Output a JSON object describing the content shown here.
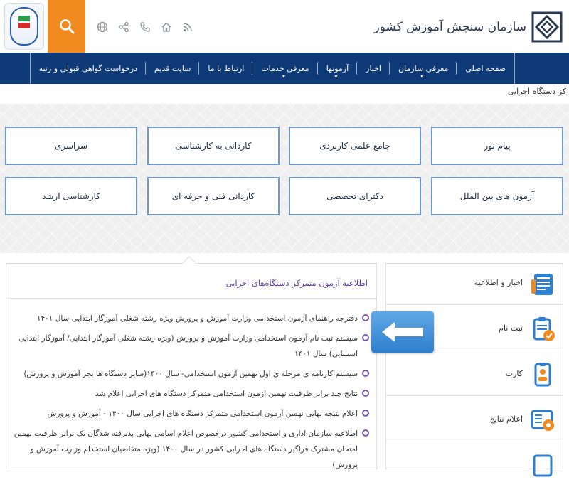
{
  "header": {
    "logo_text": "سازمان سنجش آموزش کشور",
    "icons": [
      "rss-icon",
      "home-icon",
      "phone-icon",
      "share-icon",
      "globe-icon"
    ]
  },
  "nav": {
    "items": [
      {
        "label": "صفحه اصلی",
        "dropdown": false
      },
      {
        "label": "معرفی سازمان",
        "dropdown": true
      },
      {
        "label": "اخبار",
        "dropdown": false
      },
      {
        "label": "آزمونها",
        "dropdown": true
      },
      {
        "label": "معرفی خدمات",
        "dropdown": true
      },
      {
        "label": "ارتباط با ما",
        "dropdown": false
      },
      {
        "label": "سایت قدیم",
        "dropdown": false
      },
      {
        "label": "درخواست گواهی قبولی و رتبه",
        "dropdown": false
      }
    ]
  },
  "breadcrumb": "کز دستگاه اجرایی",
  "categories": {
    "row1": [
      "پیام نور",
      "جامع علمی کاربردی",
      "کاردانی به کارشناسی",
      "سراسری"
    ],
    "row2": [
      "آزمون های بین الملل",
      "دکترای تخصصی",
      "کاردانی فنی و حرفه ای",
      "کارشناسی ارشد"
    ]
  },
  "announcements": {
    "title": "اطلاعیه آزمون متمرکز دستگاه‌های اجرایی",
    "items": [
      "دفترچه راهنمای آزمون استخدامی وزارت آموزش و پرورش ویژه رشته شغلی آموزگار ابتدایی سال ۱۴۰۱",
      "سیستم ثبت نام آزمون استخدامی وزارت آموزش و پرورش (ویژه رشته شغلی آموزگار ابتدایی/ آموزگار ابتدایی استثنایی) سال ۱۴۰۱",
      "سیستم کارنامه ی مرحله ی اول نهمین آزمون استخدامی- سال ۱۴۰۰(سایر دستگاه ها بجز آموزش و پرورش)",
      "نتایج چند برابر ظرفیت نهمین ازمون استخدامی متمرکز دستگاه های اجرایی اعلام شد",
      "اعلام نتیجه نهایی نهمین آزمون استخدامی متمرکز دستگاه های اجرایی سال ۱۴۰۰ - آموزش و پرورش",
      "اطلاعیه سازمان اداری و استخدامی کشور درخصوص اعلام اسامی نهایی پذیرفته شدگان یک برابر ظرفیت نهمین امتحان مشترک فراگیر دستگاه های اجرایی کشور در سال ۱۴۰۰ (ویژه متقاضیان استخدام وزارت آموزش و پرورش)"
    ]
  },
  "sidebar": {
    "items": [
      {
        "label": "اخبار و اطلاعیه",
        "icon": "news-icon"
      },
      {
        "label": "ثبت نام",
        "icon": "registration-icon"
      },
      {
        "label": "کارت",
        "icon": "card-icon"
      },
      {
        "label": "اعلام نتایج",
        "icon": "results-icon"
      },
      {
        "label": "",
        "icon": "document-icon"
      }
    ]
  },
  "colors": {
    "nav_bg": "#0e3a78",
    "search_bg": "#f18a1f",
    "accent_purple": "#7b5bb5",
    "button_border": "#6f97c9",
    "arrow_blue": "#2d7fcf"
  }
}
